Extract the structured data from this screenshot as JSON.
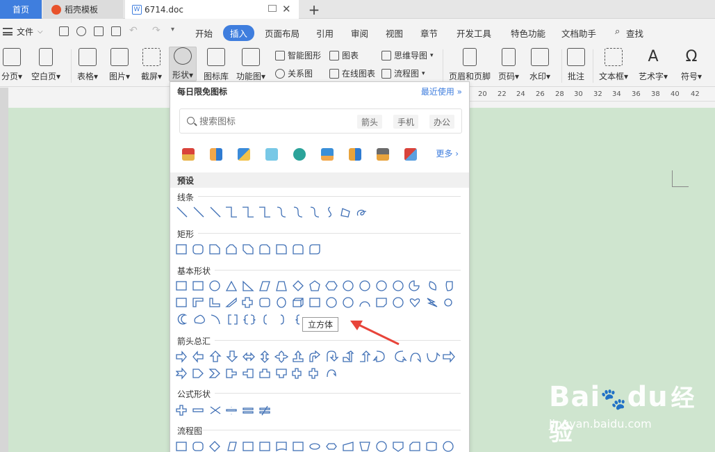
{
  "tabs": {
    "home": "首页",
    "templates": "稻壳模板",
    "document": "6714.doc"
  },
  "menu": {
    "file": "文件",
    "items": [
      "开始",
      "插入",
      "页面布局",
      "引用",
      "审阅",
      "视图",
      "章节",
      "开发工具",
      "特色功能",
      "文档助手"
    ],
    "active": "插入",
    "search": "查找"
  },
  "ribbon": {
    "page_break": "分页",
    "blank_page": "空白页",
    "table": "表格",
    "picture": "图片",
    "screenshot": "截屏",
    "shape": "形状",
    "icon_lib": "图标库",
    "function_chart": "功能图",
    "smart_art": "智能图形",
    "chart": "图表",
    "relation": "关系图",
    "online_chart": "在线图表",
    "mind_map": "思维导图",
    "flowchart": "流程图",
    "header_footer": "页眉和页脚",
    "page_number": "页码",
    "watermark": "水印",
    "comment": "批注",
    "textbox": "文本框",
    "wordart": "艺术字",
    "symbol": "符号"
  },
  "ruler": [
    "20",
    "22",
    "24",
    "26",
    "28",
    "30",
    "32",
    "34",
    "36",
    "38",
    "40",
    "42"
  ],
  "panel": {
    "title": "每日限免图标",
    "recent": "最近使用",
    "search_placeholder": "搜索图标",
    "chips": [
      "箭头",
      "手机",
      "办公"
    ],
    "more": "更多",
    "presets": "预设",
    "categories": {
      "lines": "线条",
      "rect": "矩形",
      "basic": "基本形状",
      "arrows": "箭头总汇",
      "equation": "公式形状",
      "flowchart": "流程图"
    },
    "tooltip": "立方体"
  },
  "watermark_text": {
    "brand": "Bai",
    "suffix": "du",
    "jingyan": "经验",
    "url": "jingyan.baidu.com"
  },
  "colors": {
    "accent": "#3f7ede",
    "page_bg": "#cfe5cf",
    "shape_stroke": "#3f6fb5",
    "arrow": "#e8443a"
  }
}
